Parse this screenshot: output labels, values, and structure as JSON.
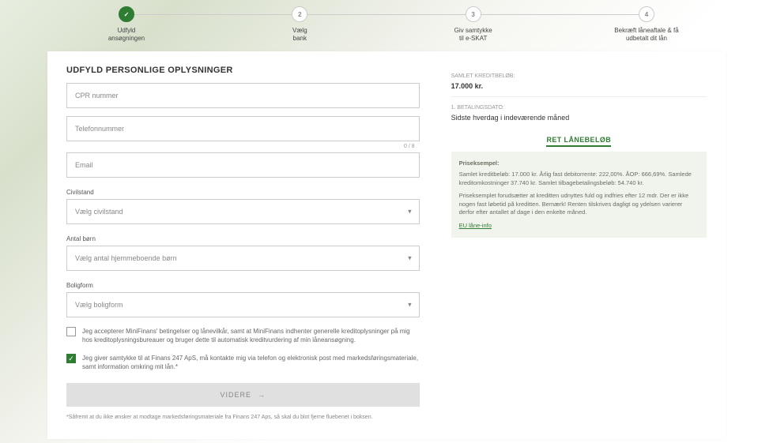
{
  "stepper": {
    "steps": [
      {
        "num": "✓",
        "label": "Udfyld\nansøgningen",
        "active": true
      },
      {
        "num": "2",
        "label": "Vælg\nbank",
        "active": false
      },
      {
        "num": "3",
        "label": "Giv samtykke\ntil e-SKAT",
        "active": false
      },
      {
        "num": "4",
        "label": "Bekræft låneaftale & få\nudbetalt dit lån",
        "active": false
      }
    ]
  },
  "form": {
    "heading": "UDFYLD PERSONLIGE OPLYSNINGER",
    "cpr_placeholder": "CPR nummer",
    "phone_placeholder": "Telefonnummer",
    "phone_counter": "0 / 8",
    "email_placeholder": "Email",
    "civil_label": "Civilstand",
    "civil_placeholder": "Vælg civilstand",
    "children_label": "Antal børn",
    "children_placeholder": "Vælg antal hjemmeboende børn",
    "housing_label": "Boligform",
    "housing_placeholder": "Vælg boligform",
    "terms_text": "Jeg accepterer MiniFinans' betingelser og lånevilkår, samt at MiniFinans indhenter generelle kreditoplysninger på mig hos kreditoplysningsbureauer og bruger dette til automatisk kreditvurdering af min låneansøgning.",
    "marketing_text": "Jeg giver samtykke til at Finans 247 ApS, må kontakte mig via telefon og elektronisk post med markedsføringsmateriale, samt information omkring mit lån.*",
    "submit_label": "VIDERE",
    "footnote": "*Såfremt at du ikke ønsker at modtage markedsføringsmateriale fra Finans 247 Aps, så skal du blot fjerne fluebenet i boksen."
  },
  "summary": {
    "credit_label": "SAMLET KREDITBELØB:",
    "credit_value": "17.000 kr.",
    "pay_label": "1. BETALINGSDATO:",
    "pay_value": "Sidste hverdag i indeværende måned",
    "edit_link": "RET LÅNEBELØB"
  },
  "example": {
    "title": "Priseksempel:",
    "line1": "Samlet kreditbeløb: 17.000 kr. Årlig fast debitorrente: 222,00%. ÅOP: 666,69%. Samlede kreditomkostninger 37.740 kr. Samlet tilbagebetalingsbeløb: 54.740 kr.",
    "line2": "Priseksemplet forudsætter at kreditten udnyttes fuld og indfries efter 12 mdr. Der er ikke nogen fast løbetid på kreditten. Bemærk! Renten tilskrives dagligt og ydelsen varierer derfor efter antallet af dage i den enkelte måned.",
    "link": "EU låne-info"
  }
}
